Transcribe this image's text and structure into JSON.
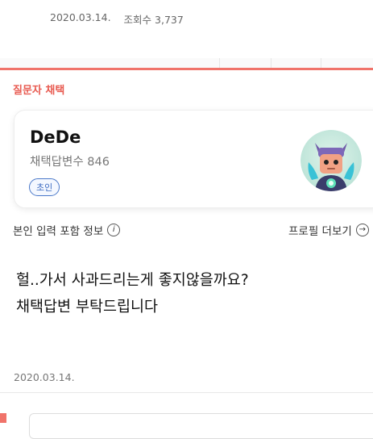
{
  "post": {
    "date": "2020.03.14.",
    "views": "조회수 3,737"
  },
  "answer": {
    "section_label": "질문자 채택",
    "profile": {
      "nickname": "DeDe",
      "answer_count": "채택답변수 846",
      "level": "초인"
    },
    "info_label": "본인 입력 포함 정보",
    "info_icon": "i",
    "profile_more": "프로필 더보기",
    "text_lines": [
      "헐..가서 사과드리는게 좋지않을까요?",
      "채택답변 부탁드립니다"
    ],
    "date": "2020.03.14."
  },
  "colors": {
    "accent": "#f0736a",
    "label_red": "#e85a50",
    "badge_blue": "#3d6bc2"
  }
}
